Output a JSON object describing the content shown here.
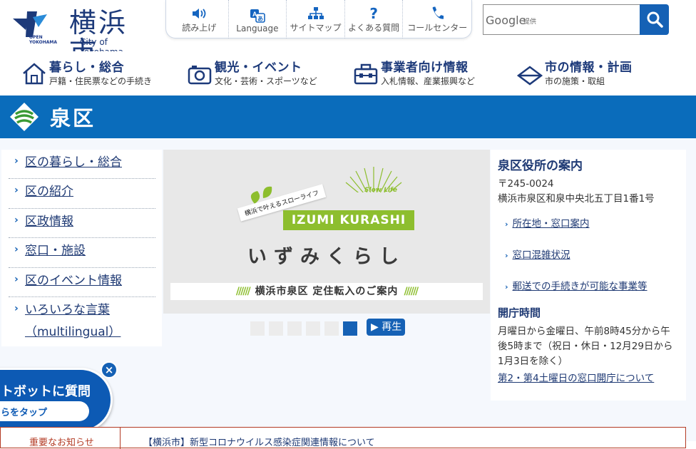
{
  "header": {
    "logo_open": "OPEN",
    "logo_yokohama": "YOKOHAMA",
    "city_name": "横浜市",
    "city_english": "City of Yokohama"
  },
  "toolbar": [
    {
      "label": "読み上げ",
      "icon": "speaker-icon"
    },
    {
      "label": "Language",
      "icon": "translate-icon"
    },
    {
      "label": "サイトマップ",
      "icon": "sitemap-icon"
    },
    {
      "label": "よくある質問",
      "icon": "question-icon"
    },
    {
      "label": "コールセンター",
      "icon": "phone-icon"
    }
  ],
  "search": {
    "google": "Google",
    "provided": "提供"
  },
  "global_nav": [
    {
      "title": "暮らし・総合",
      "sub": "戸籍・住民票などの手続き",
      "icon": "house-icon"
    },
    {
      "title": "観光・イベント",
      "sub": "文化・芸術・スポーツなど",
      "icon": "camera-icon"
    },
    {
      "title": "事業者向け情報",
      "sub": "入札情報、産業振興など",
      "icon": "toolbox-icon"
    },
    {
      "title": "市の情報・計画",
      "sub": "市の施策・取組",
      "icon": "diamond-icon"
    }
  ],
  "ward": {
    "name": "泉区"
  },
  "side_nav": [
    {
      "label": "区の暮らし・総合"
    },
    {
      "label": "区の紹介"
    },
    {
      "label": "区政情報"
    },
    {
      "label": "窓口・施設"
    },
    {
      "label": "区のイベント情報"
    },
    {
      "label": "いろいろな言葉",
      "label2": "（multilingual）"
    }
  ],
  "slide": {
    "tag": "横浜で叶えるスローライフ",
    "slow_life": "Slow Life",
    "brand": "IZUMI KURASHI",
    "title": "いずみくらし",
    "strip_decor": "//////",
    "strip": "横浜市泉区 定住転入のご案内"
  },
  "slider": {
    "dot_count": 6,
    "active_dot": 6,
    "play": "再生"
  },
  "office": {
    "heading": "泉区役所の案内",
    "postal": "〒245-0024",
    "address": "横浜市泉区和泉中央北五丁目1番1号",
    "links": [
      "所在地・窓口案内",
      "窓口混雑状況",
      "郵送での手続きが可能な事業等"
    ],
    "hours_heading": "開庁時間",
    "hours_line1": "月曜日から金曜日、午前8時45分から午",
    "hours_line2": "後5時まで（祝日・休日・12月29日から",
    "hours_line3": "1月3日を除く）",
    "hours_link": "第2・第4土曜日の窓口開庁について"
  },
  "chatbot": {
    "question": "トボットに質問",
    "tap": "らをタップ",
    "close": "×"
  },
  "ticker": {
    "label": "重要なお知らせ",
    "text": "【横浜市】新型コロナウイルス感染症関連情報について"
  }
}
